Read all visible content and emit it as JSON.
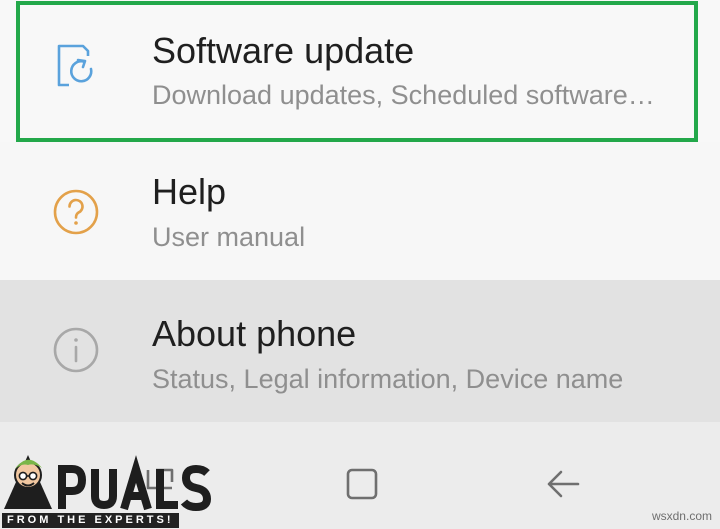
{
  "settings": {
    "items": [
      {
        "title": "Software update",
        "subtitle": "Download updates, Scheduled software…",
        "icon": "software-update-icon",
        "icon_color": "#5aa2dc",
        "highlighted": true
      },
      {
        "title": "Help",
        "subtitle": "User manual",
        "icon": "help-icon",
        "icon_color": "#e3a14a",
        "highlighted": false
      },
      {
        "title": "About phone",
        "subtitle": "Status, Legal information, Device name",
        "icon": "info-icon",
        "icon_color": "#a8a8a8",
        "highlighted": false,
        "pressed": true
      }
    ],
    "highlight_color": "#23a84a"
  },
  "navbar": {
    "buttons": [
      "recent-apps-icon",
      "home-icon",
      "back-icon"
    ]
  },
  "branding": {
    "logo_text": "APPUALS",
    "tagline": "FROM THE EXPERTS!",
    "watermark": "wsxdn.com"
  }
}
